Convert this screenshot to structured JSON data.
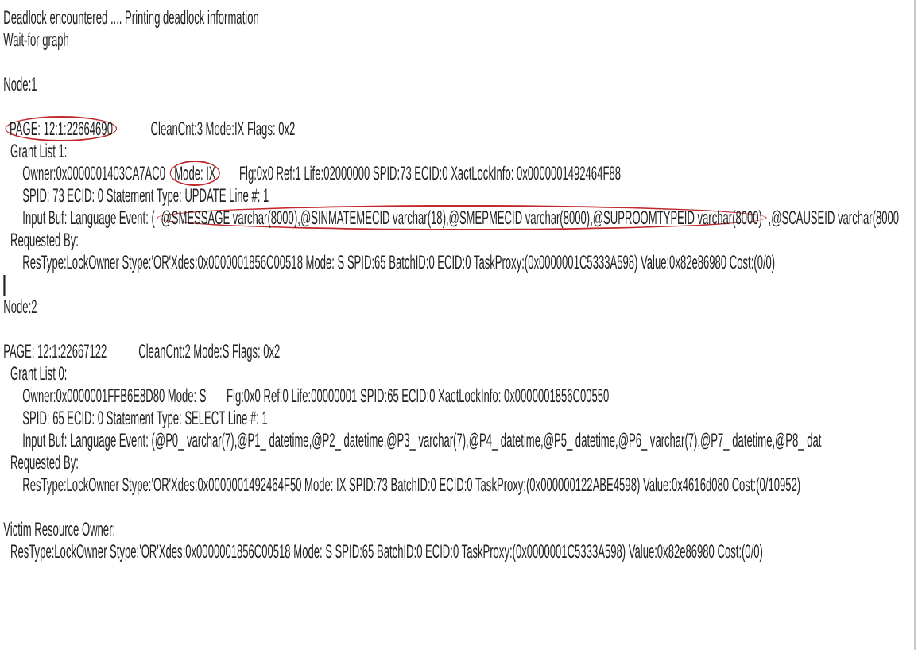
{
  "lines": [
    {
      "kind": "top",
      "segments": [
        {
          "text": "Deadlock encountered .... Printing deadlock information",
          "circled": false
        }
      ]
    },
    {
      "kind": "top",
      "segments": [
        {
          "text": "Wait-for graph",
          "circled": false
        }
      ]
    },
    {
      "kind": "blank"
    },
    {
      "kind": "top",
      "segments": [
        {
          "text": "Node:1",
          "circled": false
        }
      ]
    },
    {
      "kind": "blank"
    },
    {
      "kind": "top",
      "segments": [
        {
          "text": "PAGE: 12:1:22664690",
          "circled": true
        },
        {
          "text": "           CleanCnt:3 Mode:IX Flags: 0x2",
          "circled": false
        }
      ]
    },
    {
      "kind": "list",
      "segments": [
        {
          "text": "Grant List 1:",
          "circled": false
        }
      ]
    },
    {
      "kind": "detail",
      "segments": [
        {
          "text": "Owner:0x0000001403CA7AC0 ",
          "circled": false
        },
        {
          "text": "Mode: IX",
          "circled": true
        },
        {
          "text": "      Flg:0x0 Ref:1 Life:02000000 SPID:73 ECID:0 XactLockInfo: 0x0000001492464F88",
          "circled": false
        }
      ]
    },
    {
      "kind": "detail",
      "segments": [
        {
          "text": "SPID: 73 ECID: 0 Statement Type: UPDATE Line #: 1",
          "circled": false
        }
      ]
    },
    {
      "kind": "detail",
      "segments": [
        {
          "text": "Input Buf: Language Event: (",
          "circled": false
        },
        {
          "text": "@SMESSAGE varchar(8000),@SINMATEMECID varchar(18),@SMEPMECID varchar(8000),@SUPROOMTYPEID varchar(8000)",
          "circled": true
        },
        {
          "text": ",@SCAUSEID varchar(8000",
          "circled": false
        }
      ]
    },
    {
      "kind": "list",
      "segments": [
        {
          "text": "Requested By:",
          "circled": false
        }
      ]
    },
    {
      "kind": "detail",
      "segments": [
        {
          "text": "ResType:LockOwner Stype:'OR'Xdes:0x0000001856C00518 Mode: S SPID:65 BatchID:0 ECID:0 TaskProxy:(0x0000001C5333A598) Value:0x82e86980 Cost:(0/0)",
          "circled": false
        }
      ]
    },
    {
      "kind": "cursor"
    },
    {
      "kind": "top",
      "segments": [
        {
          "text": "Node:2",
          "circled": false
        }
      ]
    },
    {
      "kind": "blank"
    },
    {
      "kind": "top",
      "segments": [
        {
          "text": "PAGE: 12:1:22667122",
          "circled": false
        },
        {
          "text": "           CleanCnt:2 Mode:S Flags: 0x2",
          "circled": false
        }
      ]
    },
    {
      "kind": "list",
      "segments": [
        {
          "text": "Grant List 0:",
          "circled": false
        }
      ]
    },
    {
      "kind": "detail",
      "segments": [
        {
          "text": "Owner:0x0000001FFB6E8D80 Mode: S       Flg:0x0 Ref:0 Life:00000001 SPID:65 ECID:0 XactLockInfo: 0x0000001856C00550",
          "circled": false
        }
      ]
    },
    {
      "kind": "detail",
      "segments": [
        {
          "text": "SPID: 65 ECID: 0 Statement Type: SELECT Line #: 1",
          "circled": false
        }
      ]
    },
    {
      "kind": "detail",
      "segments": [
        {
          "text": "Input Buf: Language Event: (@P0_ varchar(7),@P1_ datetime,@P2_ datetime,@P3_ varchar(7),@P4_ datetime,@P5_ datetime,@P6_ varchar(7),@P7_ datetime,@P8_ dat",
          "circled": false
        }
      ]
    },
    {
      "kind": "list",
      "segments": [
        {
          "text": "Requested By:",
          "circled": false
        }
      ]
    },
    {
      "kind": "detail",
      "segments": [
        {
          "text": "ResType:LockOwner Stype:'OR'Xdes:0x0000001492464F50 Mode: IX SPID:73 BatchID:0 ECID:0 TaskProxy:(0x000000122ABE4598) Value:0x4616d080 Cost:(0/10952)",
          "circled": false
        }
      ]
    },
    {
      "kind": "blank"
    },
    {
      "kind": "top",
      "segments": [
        {
          "text": "Victim Resource Owner:",
          "circled": false
        }
      ]
    },
    {
      "kind": "list",
      "segments": [
        {
          "text": "ResType:LockOwner Stype:'OR'Xdes:0x0000001856C00518 Mode: S SPID:65 BatchID:0 ECID:0 TaskProxy:(0x0000001C5333A598) Value:0x82e86980 Cost:(0/0)",
          "circled": false
        }
      ]
    }
  ]
}
